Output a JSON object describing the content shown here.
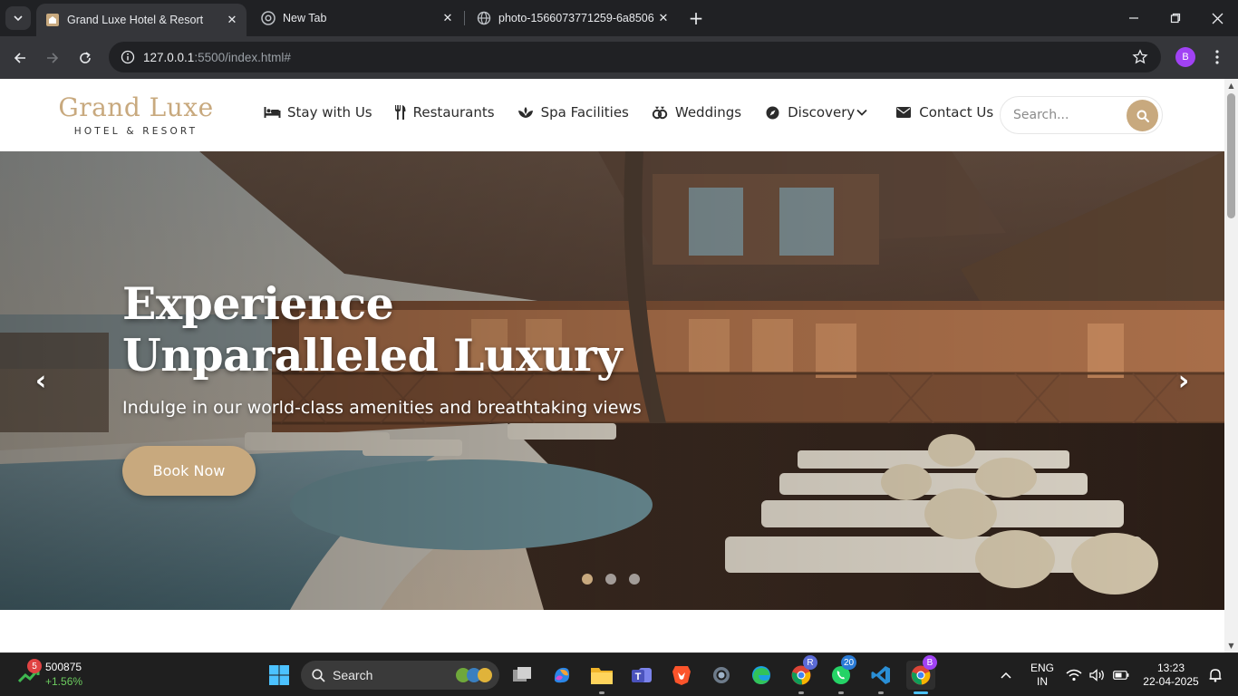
{
  "browser": {
    "tabs": [
      {
        "title": "Grand Luxe Hotel & Resort",
        "active": true
      },
      {
        "title": "New Tab",
        "active": false
      },
      {
        "title": "photo-1566073771259-6a8506",
        "active": false
      }
    ],
    "url_host": "127.0.0.1",
    "url_rest": ":5500/index.html#",
    "profile_initial": "B"
  },
  "site": {
    "logo": {
      "name": "Grand Luxe",
      "tagline": "HOTEL & RESORT"
    },
    "nav": [
      {
        "label": "Stay with Us",
        "icon": "bed-icon"
      },
      {
        "label": "Restaurants",
        "icon": "utensils-icon"
      },
      {
        "label": "Spa Facilities",
        "icon": "spa-icon"
      },
      {
        "label": "Weddings",
        "icon": "rings-icon"
      },
      {
        "label": "Discovery",
        "icon": "compass-icon"
      },
      {
        "label": "Contact Us",
        "icon": "envelope-icon"
      }
    ],
    "search_placeholder": "Search...",
    "hero": {
      "title": "Experience Unparalleled Luxury",
      "subtitle": "Indulge in our world-class amenities and breathtaking views",
      "cta": "Book Now",
      "prev": "‹",
      "next": "›",
      "slide_count": 3,
      "active_slide": 1
    }
  },
  "colors": {
    "accent": "#c8a97e",
    "header_bg": "#ffffff",
    "browser_bg": "#202124"
  },
  "taskbar": {
    "stock_badge": "5",
    "stock_value": "500875",
    "stock_change": "+1.56%",
    "search_label": "Search",
    "whatsapp_badge": "20",
    "chrome_profile_badge": "R",
    "active_chrome_badge": "B",
    "language": "ENG",
    "region": "IN",
    "time": "13:23",
    "date": "22-04-2025"
  }
}
